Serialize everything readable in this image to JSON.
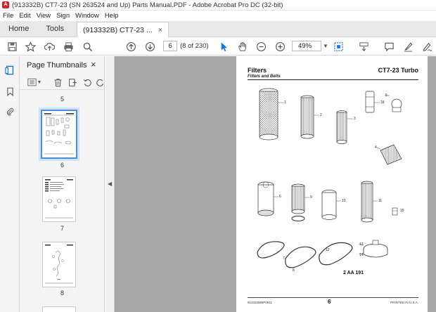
{
  "window": {
    "title": "(913332B) CT7-23 (SN 263524 and Up) Parts Manual.PDF - Adobe Acrobat Pro DC (32-bit)"
  },
  "menu": [
    "File",
    "Edit",
    "View",
    "Sign",
    "Window",
    "Help"
  ],
  "tabs": {
    "home": "Home",
    "tools": "Tools",
    "document": "(913332B) CT7-23 ...",
    "close": "×"
  },
  "toolbar": {
    "page_number": "6",
    "page_count": "(8 of 230)",
    "zoom": "49%",
    "icons": [
      "save-icon",
      "bookmark-star-icon",
      "upload-cloud-icon",
      "print-icon",
      "find-icon",
      "page-up-icon",
      "page-down-icon",
      "select-cursor-icon",
      "hand-icon",
      "zoom-out-icon",
      "zoom-in-icon",
      "fit-page-icon",
      "scroll-mode-icon",
      "comment-icon",
      "highlight-icon",
      "sign-icon"
    ]
  },
  "thumbnails_panel": {
    "title": "Page Thumbnails",
    "close": "×",
    "labels": [
      "5",
      "6",
      "7",
      "8"
    ]
  },
  "document": {
    "heading": "Filters",
    "heading_right": "CT7-23 Turbo",
    "subheading": "Filters and Belts",
    "part_number": "2 AA 191",
    "footer_left": "913332B/BP0511",
    "footer_center": "6",
    "footer_right": "PRINTED IN U.S.A.",
    "callouts": [
      "1",
      "2",
      "3",
      "5",
      "18",
      "4",
      "6",
      "9",
      "10",
      "11",
      "15",
      "7",
      "8",
      "12",
      "13",
      "14"
    ]
  },
  "colors": {
    "accent": "#1473e6",
    "doc_background": "#a6a6a6",
    "pdf_red": "#d4242a"
  }
}
